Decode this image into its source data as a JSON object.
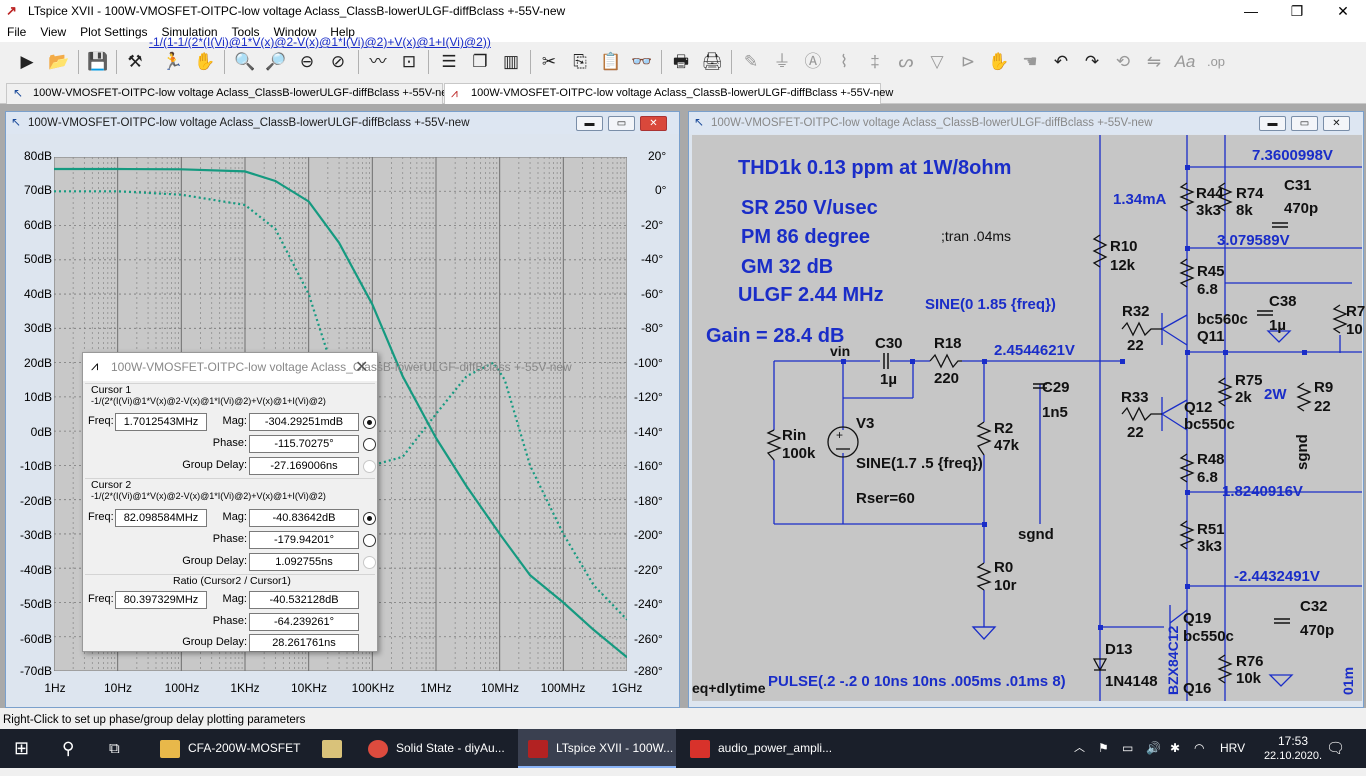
{
  "app": {
    "title": "LTspice XVII - 100W-VMOSFET-OITPC-low voltage Aclass_ClassB-lowerULGF-diffBclass +-55V-new"
  },
  "menu": [
    "File",
    "View",
    "Plot Settings",
    "Simulation",
    "Tools",
    "Window",
    "Help"
  ],
  "tabs": [
    {
      "label": "100W-VMOSFET-OITPC-low voltage Aclass_ClassB-lowerULGF-diffBclass +-55V-new",
      "icon": "schematic-icon"
    },
    {
      "label": "100W-VMOSFET-OITPC-low voltage Aclass_ClassB-lowerULGF-diffBclass +-55V-new",
      "icon": "waveform-icon"
    }
  ],
  "plot_window": {
    "title": "100W-VMOSFET-OITPC-low voltage Aclass_ClassB-lowerULGF-diffBclass +-55V-new",
    "trace_label": "-1/(1-1/(2*(I(Vi)@1*V(x)@2-V(x)@1*I(Vi)@2)+V(x)@1+I(Vi)@2))",
    "y_ticks": [
      "80dB",
      "70dB",
      "60dB",
      "50dB",
      "40dB",
      "30dB",
      "20dB",
      "10dB",
      "0dB",
      "-10dB",
      "-20dB",
      "-30dB",
      "-40dB",
      "-50dB",
      "-60dB",
      "-70dB"
    ],
    "phase_ticks": [
      "20°",
      "0°",
      "-20°",
      "-40°",
      "-60°",
      "-80°",
      "-100°",
      "-120°",
      "-140°",
      "-160°",
      "-180°",
      "-200°",
      "-220°",
      "-240°",
      "-260°",
      "-280°"
    ],
    "x_ticks": [
      "1Hz",
      "10Hz",
      "100Hz",
      "1KHz",
      "10KHz",
      "100KHz",
      "1MHz",
      "10MHz",
      "100MHz",
      "1GHz"
    ]
  },
  "chart_data": {
    "type": "line",
    "xscale": "log",
    "x_label_units": "Hz",
    "xlim": [
      1,
      1000000000
    ],
    "ylim_magnitude_dB": [
      -70,
      80
    ],
    "ylim_phase_deg": [
      -280,
      20
    ],
    "grid": true,
    "series": [
      {
        "axis": "magnitude",
        "style": "solid",
        "color": "#159a80",
        "points": [
          [
            1,
            76.5
          ],
          [
            10,
            76.5
          ],
          [
            100,
            76.4
          ],
          [
            1000,
            75.8
          ],
          [
            3000,
            73
          ],
          [
            10000,
            67
          ],
          [
            30000,
            55
          ],
          [
            100000,
            37
          ],
          [
            300000,
            16
          ],
          [
            1000000,
            -2
          ],
          [
            3000000,
            -16
          ],
          [
            10000000,
            -30
          ],
          [
            30000000,
            -42
          ],
          [
            100000000,
            -50
          ],
          [
            300000000,
            -58
          ],
          [
            1000000000,
            -66
          ]
        ]
      },
      {
        "axis": "phase",
        "style": "dotted",
        "color": "#159a80",
        "points": [
          [
            1,
            0
          ],
          [
            10,
            0
          ],
          [
            100,
            -2
          ],
          [
            1000,
            -8
          ],
          [
            3000,
            -22
          ],
          [
            10000,
            -60
          ],
          [
            30000,
            -115
          ],
          [
            60000,
            -150
          ],
          [
            100000,
            -160
          ],
          [
            300000,
            -155
          ],
          [
            1000000,
            -130
          ],
          [
            3000000,
            -108
          ],
          [
            8000000,
            -100
          ],
          [
            12000000,
            -110
          ],
          [
            30000000,
            -160
          ],
          [
            100000000,
            -200
          ],
          [
            300000000,
            -230
          ],
          [
            1000000000,
            -250
          ]
        ]
      }
    ]
  },
  "cursor_dialog": {
    "title": "100W-VMOSFET-OITPC-low voltage Aclass_ClassB-lowerULGF-diffBclass +-55V-new",
    "expr": "-1/(2*(I(Vi)@1*V(x)@2-V(x)@1*I(Vi)@2)+V(x)@1+I(Vi)@2)",
    "cursor1": {
      "heading": "Cursor 1",
      "freq": "1.7012543MHz",
      "mag": "-304.29251mdB",
      "phase": "-115.70275°",
      "group_delay": "-27.169006ns"
    },
    "cursor2": {
      "heading": "Cursor 2",
      "freq": "82.098584MHz",
      "mag": "-40.83642dB",
      "phase": "-179.94201°",
      "group_delay": "1.092755ns"
    },
    "ratio": {
      "heading": "Ratio (Cursor2 / Cursor1)",
      "freq": "80.397329MHz",
      "mag": "-40.532128dB",
      "phase": "-64.239261°",
      "group_delay": "28.261761ns"
    },
    "labels": {
      "freq": "Freq:",
      "mag": "Mag:",
      "phase": "Phase:",
      "group_delay": "Group Delay:"
    }
  },
  "schematic_window": {
    "title": "100W-VMOSFET-OITPC-low voltage Aclass_ClassB-lowerULGF-diffBclass +-55V-new",
    "notes": {
      "thd": "THD1k 0.13 ppm at 1W/8ohm",
      "sr": "SR 250 V/usec",
      "pm": "PM  86 degree",
      "gm": "GM  32 dB",
      "ulgf": "ULGF 2.44 MHz",
      "gain": "Gain = 28.4 dB",
      "tran": ";tran .04ms",
      "sine_src": "SINE(0 1.85 {freq})",
      "pulse": "PULSE(.2 -.2 0 10ns 10ns .005ms .01ms 8)",
      "dly": "eq+dlytime",
      "current": "1.34mA",
      "twoW": "2W"
    },
    "voltages": [
      "7.3600998V",
      "3.079589V",
      "2.4544621V",
      "1.8240916V",
      "-2.4432491V"
    ],
    "components": [
      {
        "ref": "R44",
        "val": "3k3"
      },
      {
        "ref": "R74",
        "val": "8k"
      },
      {
        "ref": "C31",
        "val": "470p"
      },
      {
        "ref": "R10",
        "val": "12k"
      },
      {
        "ref": "R45",
        "val": "6.8"
      },
      {
        "ref": "C38",
        "val": "1µ"
      },
      {
        "ref": "R32",
        "val": "22"
      },
      {
        "ref": "Q11",
        "val": "bc560c"
      },
      {
        "ref": "R7",
        "val": "10"
      },
      {
        "ref": "C30",
        "val": "1µ"
      },
      {
        "ref": "R18",
        "val": "220"
      },
      {
        "ref": "C29",
        "val": "1n5"
      },
      {
        "ref": "R33",
        "val": "22"
      },
      {
        "ref": "Q12",
        "val": "bc550c"
      },
      {
        "ref": "R75",
        "val": "2k"
      },
      {
        "ref": "R9",
        "val": "22"
      },
      {
        "ref": "V3",
        "val": "SINE(1.7 .5 {freq})"
      },
      {
        "ref": "Rin",
        "val": "100k"
      },
      {
        "ref": "R2",
        "val": "47k"
      },
      {
        "ref": "R48",
        "val": "6.8"
      },
      {
        "ref": "R51",
        "val": "3k3"
      },
      {
        "ref": "R0",
        "val": "10r"
      },
      {
        "ref": "C32",
        "val": "470p"
      },
      {
        "ref": "Q19",
        "val": "bc550c"
      },
      {
        "ref": "R76",
        "val": "10k"
      },
      {
        "ref": "D13",
        "val": "1N4148"
      },
      {
        "ref": "Q16",
        "val": ""
      }
    ],
    "rser": "Rser=60",
    "net_vin": "vin",
    "net_sgnd": "sgnd",
    "net_sgnd2": "sgnd",
    "vert_label": "BZX84C12",
    "edge_label": "01m"
  },
  "status": "Right-Click to set up phase/group delay plotting parameters",
  "taskbar": {
    "apps": [
      {
        "label": "CFA-200W-MOSFET",
        "color": "#e8b84a"
      },
      {
        "label": "",
        "color": "#d9c27a"
      },
      {
        "label": "Solid State - diyAu...",
        "color": "#dd4b3e"
      },
      {
        "label": "LTspice XVII - 100W...",
        "color": "#b22222"
      },
      {
        "label": "audio_power_ampli...",
        "color": "#d8322b"
      }
    ],
    "lang": "HRV",
    "time": "17:53",
    "date": "22.10.2020."
  }
}
